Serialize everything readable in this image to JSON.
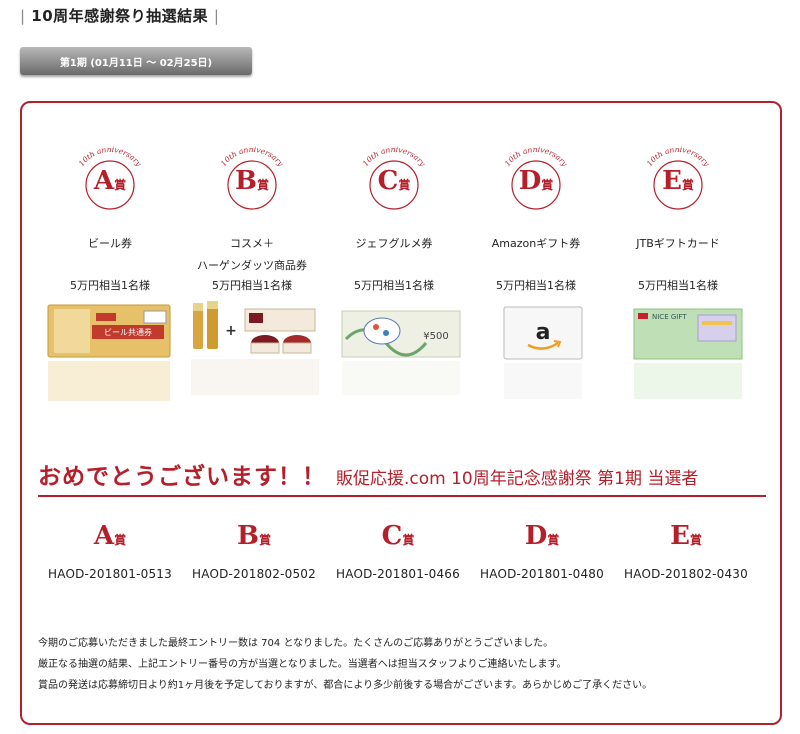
{
  "page": {
    "title": "10周年感謝祭り抽選結果",
    "period_tab": "第1期 (01月11日 〜 02月25日)"
  },
  "medal_text": "10th anniversary",
  "prizes": [
    {
      "grade": "A",
      "suffix": "賞",
      "name_line1": "ビール券",
      "name_line2": "",
      "value": "5万円相当1名様"
    },
    {
      "grade": "B",
      "suffix": "賞",
      "name_line1": "コスメ＋",
      "name_line2": "ハーゲンダッツ商品券",
      "value": "5万円相当1名様"
    },
    {
      "grade": "C",
      "suffix": "賞",
      "name_line1": "ジェフグルメ券",
      "name_line2": "",
      "value": "5万円相当1名様"
    },
    {
      "grade": "D",
      "suffix": "賞",
      "name_line1": "Amazonギフト券",
      "name_line2": "",
      "value": "5万円相当1名様"
    },
    {
      "grade": "E",
      "suffix": "賞",
      "name_line1": "JTBギフトカード",
      "name_line2": "",
      "value": "5万円相当1名様"
    }
  ],
  "images": {
    "beer_label": "ビール共通券",
    "plus": "+",
    "gourmet_text": "¥500",
    "jtb_text": "NICE GIFT"
  },
  "headline": {
    "big": "おめでとうございます！！",
    "small": "販促応援.com 10周年記念感謝祭 第1期 当選者"
  },
  "winners": [
    {
      "grade": "A",
      "suffix": "賞",
      "code": "HAOD-201801-0513"
    },
    {
      "grade": "B",
      "suffix": "賞",
      "code": "HAOD-201802-0502"
    },
    {
      "grade": "C",
      "suffix": "賞",
      "code": "HAOD-201801-0466"
    },
    {
      "grade": "D",
      "suffix": "賞",
      "code": "HAOD-201801-0480"
    },
    {
      "grade": "E",
      "suffix": "賞",
      "code": "HAOD-201802-0430"
    }
  ],
  "notes": [
    "今期のご応募いただきました最終エントリー数は 704 となりました。たくさんのご応募ありがとうございました。",
    "厳正なる抽選の結果、上記エントリー番号の方が当選となりました。当選者へは担当スタッフよりご連絡いたします。",
    "賞品の発送は応募締切日より約1ヶ月後を予定しておりますが、都合により多少前後する場合がございます。あらかじめご了承ください。"
  ],
  "colors": {
    "accent": "#b51f2a",
    "tab_dark": "#6a6a6a"
  }
}
